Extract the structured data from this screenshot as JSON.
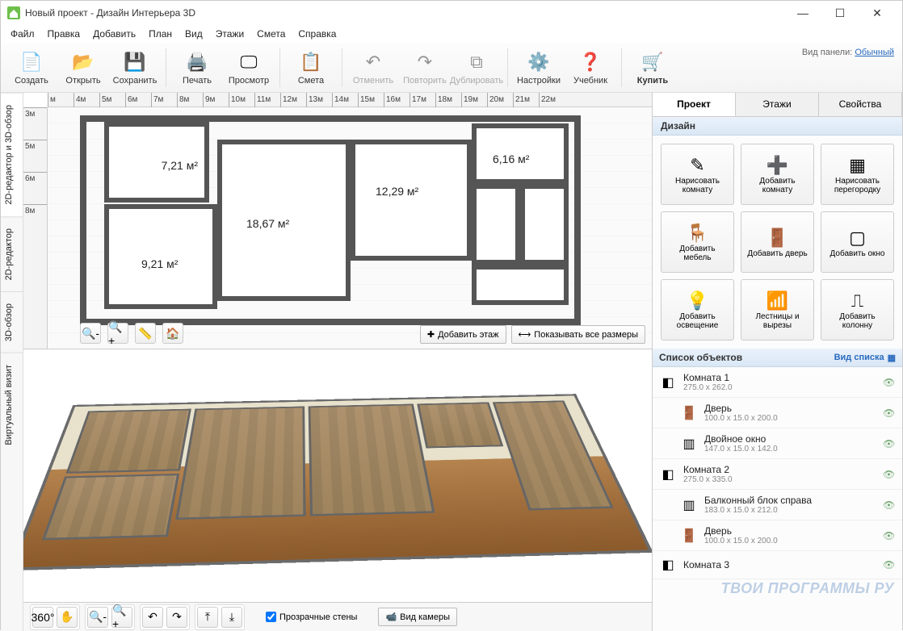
{
  "window": {
    "title": "Новый проект - Дизайн Интерьера 3D"
  },
  "menus": [
    "Файл",
    "Правка",
    "Добавить",
    "План",
    "Вид",
    "Этажи",
    "Смета",
    "Справка"
  ],
  "toolbar": {
    "create": "Создать",
    "open": "Открыть",
    "save": "Сохранить",
    "print": "Печать",
    "preview": "Просмотр",
    "estimate": "Смета",
    "undo": "Отменить",
    "redo": "Повторить",
    "duplicate": "Дублировать",
    "settings": "Настройки",
    "tutorial": "Учебник",
    "buy": "Купить",
    "panel_label": "Вид панели:",
    "panel_value": "Обычный"
  },
  "vtabs": {
    "combo": "2D-редактор и 3D-обзор",
    "editor2d": "2D-редактор",
    "view3d": "3D-обзор",
    "virtual": "Виртуальный визит"
  },
  "ruler_h": [
    "м",
    "4м",
    "5м",
    "6м",
    "7м",
    "8м",
    "9м",
    "10м",
    "11м",
    "12м",
    "13м",
    "14м",
    "15м",
    "16м",
    "17м",
    "18м",
    "19м",
    "20м",
    "21м",
    "22м"
  ],
  "ruler_v": [
    "3м",
    "5м",
    "6м",
    "8м"
  ],
  "rooms": {
    "r1": "7,21 м²",
    "r2": "9,21 м²",
    "r3": "18,67 м²",
    "r4": "12,29 м²",
    "r5": "6,16 м²"
  },
  "plan_buttons": {
    "add_floor": "Добавить этаж",
    "show_dims": "Показывать все размеры"
  },
  "bottom": {
    "transparent_walls": "Прозрачные стены",
    "camera": "Вид камеры"
  },
  "rtabs": {
    "project": "Проект",
    "floors": "Этажи",
    "props": "Свойства"
  },
  "design_header": "Дизайн",
  "design_cards": [
    {
      "label": "Нарисовать комнату",
      "icon": "✎"
    },
    {
      "label": "Добавить комнату",
      "icon": "➕"
    },
    {
      "label": "Нарисовать перегородку",
      "icon": "▦"
    },
    {
      "label": "Добавить мебель",
      "icon": "🪑"
    },
    {
      "label": "Добавить дверь",
      "icon": "🚪"
    },
    {
      "label": "Добавить окно",
      "icon": "▢"
    },
    {
      "label": "Добавить освещение",
      "icon": "💡"
    },
    {
      "label": "Лестницы и вырезы",
      "icon": "📶"
    },
    {
      "label": "Добавить колонну",
      "icon": "⎍"
    }
  ],
  "objects_header": "Список объектов",
  "view_list_label": "Вид списка",
  "objects": [
    {
      "name": "Комната 1",
      "dim": "275.0 x 262.0",
      "icon": "◧",
      "child": false
    },
    {
      "name": "Дверь",
      "dim": "100.0 x 15.0 x 200.0",
      "icon": "🚪",
      "child": true
    },
    {
      "name": "Двойное окно",
      "dim": "147.0 x 15.0 x 142.0",
      "icon": "▥",
      "child": true
    },
    {
      "name": "Комната 2",
      "dim": "275.0 x 335.0",
      "icon": "◧",
      "child": false
    },
    {
      "name": "Балконный блок справа",
      "dim": "183.0 x 15.0 x 212.0",
      "icon": "▥",
      "child": true
    },
    {
      "name": "Дверь",
      "dim": "100.0 x 15.0 x 200.0",
      "icon": "🚪",
      "child": true
    },
    {
      "name": "Комната 3",
      "dim": "",
      "icon": "◧",
      "child": false
    }
  ],
  "watermark": "ТВОИ ПРОГРАММЫ РУ"
}
